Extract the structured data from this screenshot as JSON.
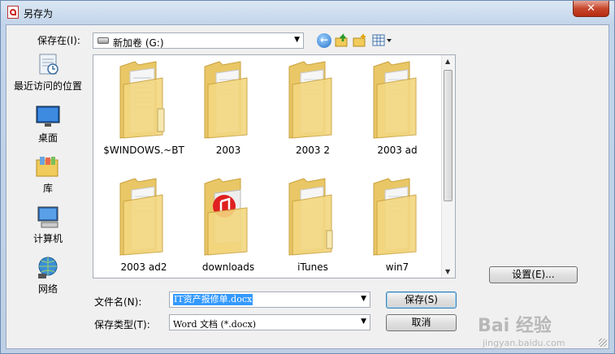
{
  "window": {
    "title": "另存为",
    "close_label": "✕"
  },
  "toolbar": {
    "save_in_label": "保存在(I):",
    "location": "新加卷 (G:)"
  },
  "places": [
    {
      "label": "最近访问的位置",
      "icon": "recent-places-icon"
    },
    {
      "label": "桌面",
      "icon": "desktop-icon"
    },
    {
      "label": "库",
      "icon": "libraries-icon"
    },
    {
      "label": "计算机",
      "icon": "computer-icon"
    },
    {
      "label": "网络",
      "icon": "network-icon"
    }
  ],
  "files": [
    {
      "name": "$WINDOWS.~BT",
      "icon": "folder-icon"
    },
    {
      "name": "2003",
      "icon": "folder-icon"
    },
    {
      "name": "2003 2",
      "icon": "folder-icon"
    },
    {
      "name": "2003 ad",
      "icon": "folder-icon"
    },
    {
      "name": "2003 ad2",
      "icon": "folder-icon"
    },
    {
      "name": "downloads",
      "icon": "music-folder-icon"
    },
    {
      "name": "iTunes",
      "icon": "folder-icon"
    },
    {
      "name": "win7",
      "icon": "folder-icon"
    }
  ],
  "form": {
    "filename_label": "文件名(N):",
    "filename_value": "IT资产报修单.docx",
    "filetype_label": "保存类型(T):",
    "filetype_value": "Word 文档 (*.docx)"
  },
  "buttons": {
    "save": "保存(S)",
    "cancel": "取消",
    "settings": "设置(E)..."
  },
  "watermark": {
    "main": "Bai 经验",
    "sub": "jingyan.baidu.com"
  }
}
